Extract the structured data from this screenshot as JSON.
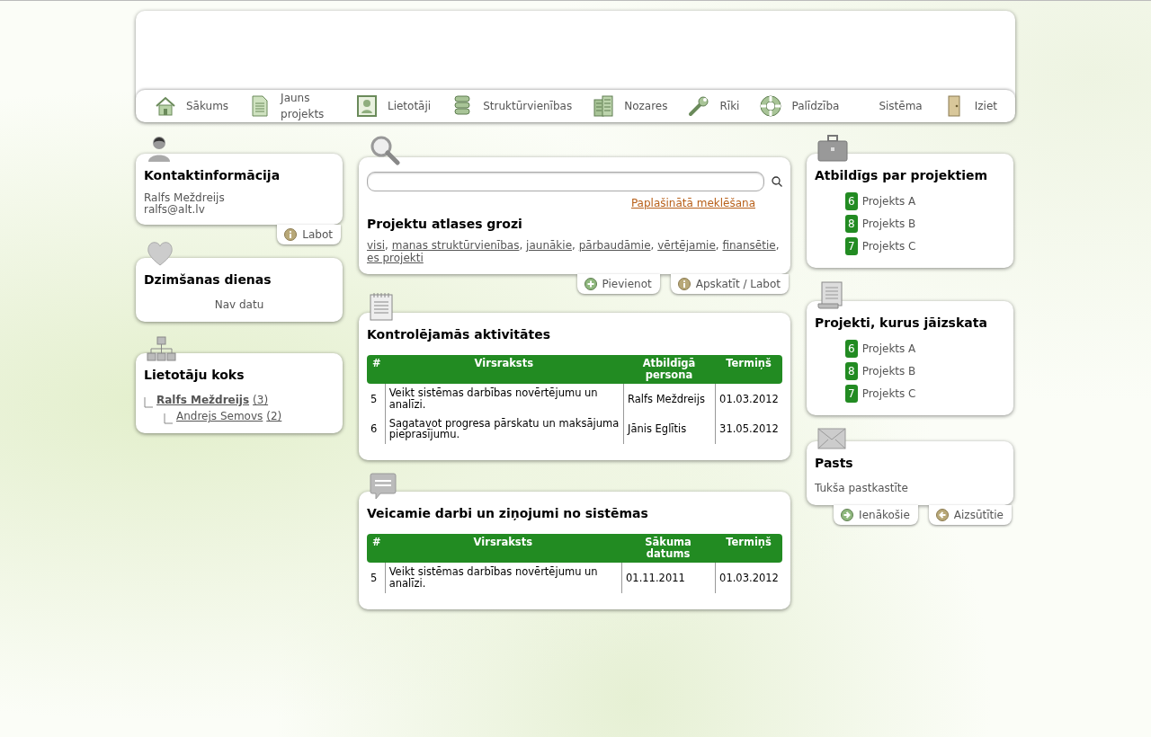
{
  "nav": {
    "left": [
      {
        "label": "Sākums"
      },
      {
        "label": "Jauns projekts"
      },
      {
        "label": "Lietotāji"
      },
      {
        "label": "Struktūrvienības"
      },
      {
        "label": "Nozares"
      },
      {
        "label": "Rīki"
      },
      {
        "label": "Palīdzība"
      }
    ],
    "right": [
      {
        "label": "Sistēma"
      },
      {
        "label": "Iziet"
      }
    ]
  },
  "contact": {
    "title": "Kontaktinformācija",
    "lines": [
      "Ralfs Meždreijs",
      "ralfs@alt.lv"
    ],
    "actions": [
      {
        "kind": "info",
        "label": "Labot"
      }
    ]
  },
  "birthdays": {
    "title": "Dzimšanas dienas",
    "empty": "Nav datu"
  },
  "user_tree": {
    "title": "Lietotāju koks",
    "children": [
      {
        "name": "Ralfs Meždreijs",
        "count": "(3)",
        "children": [
          {
            "name": "Andrejs Semovs",
            "count": "(2)"
          }
        ]
      }
    ]
  },
  "search": {
    "advanced_link": "Paplašinātā meklēšana",
    "baskets_title": "Projektu atlases grozi",
    "separator": ",",
    "links": [
      "visi",
      "manas struktūrvienības",
      "jaunākie",
      "pārbaudāmie",
      "vērtējamie",
      "finansētie",
      "es projekti"
    ],
    "actions": [
      {
        "kind": "add",
        "label": "Pievienot"
      },
      {
        "kind": "info",
        "label": "Apskatīt / Labot"
      }
    ]
  },
  "activities": {
    "title": "Kontrolējamās aktivitātes",
    "columns": [
      "#",
      "Virsraksts",
      "Atbildīgā persona",
      "Termiņš"
    ],
    "rows": [
      [
        "5",
        "Veikt sistēmas darbības novērtējumu un analīzi.",
        "Ralfs Meždreijs",
        "01.03.2012"
      ],
      [
        "6",
        "Sagatavot progresa pārskatu un maksājuma pieprasījumu.",
        "Jānis Eglītis",
        "31.05.2012"
      ]
    ]
  },
  "tasks": {
    "title": "Veicamie darbi un ziņojumi no sistēmas",
    "columns": [
      "#",
      "Virsraksts",
      "Sākuma datums",
      "Termiņš"
    ],
    "rows": [
      [
        "5",
        "Veikt sistēmas darbības novērtējumu un analīzi.",
        "01.11.2011",
        "01.03.2012"
      ]
    ]
  },
  "responsible": {
    "title": "Atbildīgs par projektiem",
    "items": [
      {
        "count": "6",
        "name": "Projekts A"
      },
      {
        "count": "8",
        "name": "Projekts B"
      },
      {
        "count": "7",
        "name": "Projekts C"
      }
    ]
  },
  "to_review": {
    "title": "Projekti, kurus jāizskata",
    "items": [
      {
        "count": "6",
        "name": "Projekts A"
      },
      {
        "count": "8",
        "name": "Projekts B"
      },
      {
        "count": "7",
        "name": "Projekts C"
      }
    ]
  },
  "mail": {
    "title": "Pasts",
    "text": "Tukša pastkastīte",
    "actions": [
      {
        "kind": "inbox",
        "label": "Ienākošie"
      },
      {
        "kind": "sent",
        "label": "Aizsūtītie"
      }
    ]
  }
}
